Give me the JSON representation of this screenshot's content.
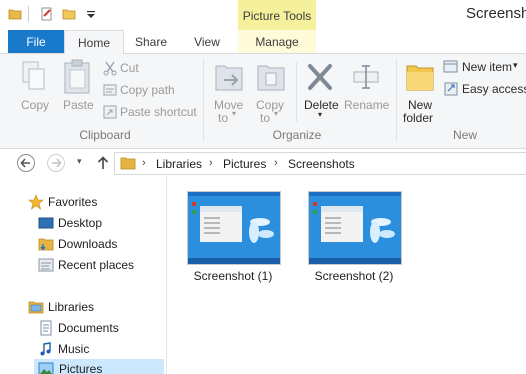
{
  "window": {
    "title": "Screensho"
  },
  "contextual_tab": {
    "label": "Picture Tools"
  },
  "tabs": [
    {
      "label": "File"
    },
    {
      "label": "Home"
    },
    {
      "label": "Share"
    },
    {
      "label": "View"
    },
    {
      "label": "Manage"
    }
  ],
  "ribbon": {
    "clipboard": {
      "copy": "Copy",
      "paste": "Paste",
      "cut": "Cut",
      "copy_path": "Copy path",
      "paste_shortcut": "Paste shortcut",
      "group": "Clipboard"
    },
    "organize": {
      "move_to_1": "Move",
      "move_to_2": "to",
      "copy_to_1": "Copy",
      "copy_to_2": "to",
      "delete": "Delete",
      "rename": "Rename",
      "group": "Organize"
    },
    "new": {
      "new_folder_1": "New",
      "new_folder_2": "folder",
      "new_item": "New item",
      "easy_access": "Easy access",
      "group": "New"
    }
  },
  "address": {
    "crumbs": [
      "Libraries",
      "Pictures",
      "Screenshots"
    ]
  },
  "nav": {
    "favorites": "Favorites",
    "desktop": "Desktop",
    "downloads": "Downloads",
    "recent": "Recent places",
    "libraries": "Libraries",
    "documents": "Documents",
    "music": "Music",
    "pictures": "Pictures"
  },
  "files": [
    {
      "name": "Screenshot (1)"
    },
    {
      "name": "Screenshot (2)"
    }
  ],
  "colors": {
    "file_tab": "#1979ca",
    "contextual_tab": "#f5f09c",
    "selection": "#cce8ff"
  }
}
